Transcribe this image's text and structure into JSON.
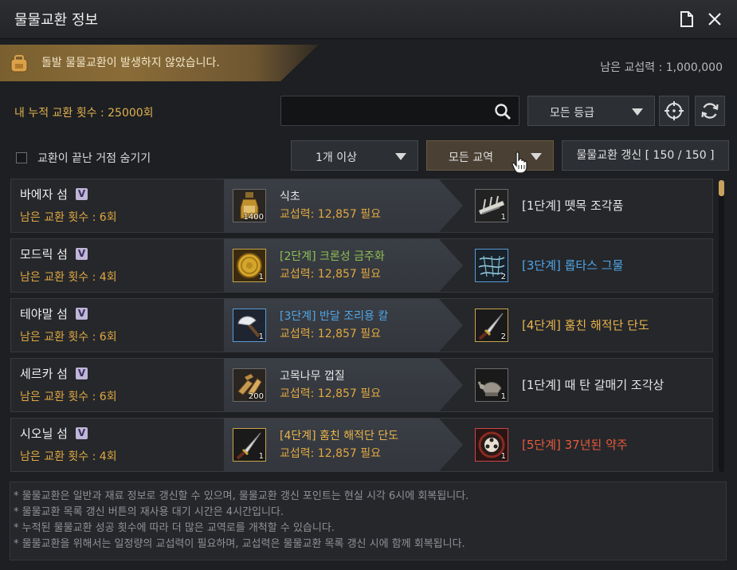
{
  "window": {
    "title": "물물교환 정보"
  },
  "alert": {
    "message": "돌발 물물교환이 발생하지 않았습니다."
  },
  "remaining_power": "남은 교섭력 : 1,000,000",
  "cumulative_count": "내 누적 교환 횟수 : 25000회",
  "search": {
    "value": "",
    "placeholder": ""
  },
  "grade_filter": {
    "selected": "모든 등급"
  },
  "count_filter": {
    "selected": "1개 이상"
  },
  "route_filter": {
    "selected": "모든 교역"
  },
  "hide_finished": {
    "label": "교환이 끝난 거점 숨기기",
    "checked": false
  },
  "refresh_button": {
    "label": "물물교환 갱신 [ 150 / 150 ]"
  },
  "rows": [
    {
      "island": "바에자 섬",
      "badge": "V",
      "count": "남은 교환 횟수 : 6회",
      "given": {
        "name": "식초",
        "qty": "1400",
        "cost": "교섭력: 12,857 필요",
        "color": "#e6e6e6"
      },
      "received": {
        "name": "[1단계] 뗏목 조각품",
        "qty": "1",
        "color": "#e6e6e6"
      }
    },
    {
      "island": "모드릭 섬",
      "badge": "V",
      "count": "남은 교환 횟수 : 4회",
      "given": {
        "name": "[2단계] 크론성 금주화",
        "qty": "1",
        "cost": "교섭력: 12,857 필요",
        "color": "#8fbf55"
      },
      "received": {
        "name": "[3단계] 롭타스 그물",
        "qty": "2",
        "color": "#4fa6e6"
      }
    },
    {
      "island": "테야말 섬",
      "badge": "V",
      "count": "남은 교환 횟수 : 6회",
      "given": {
        "name": "[3단계] 반달 조리용 칼",
        "qty": "1",
        "cost": "교섭력: 12,857 필요",
        "color": "#4fa6e6"
      },
      "received": {
        "name": "[4단계] 훔친 해적단 단도",
        "qty": "2",
        "color": "#e9b44c"
      }
    },
    {
      "island": "세르카 섬",
      "badge": "V",
      "count": "남은 교환 횟수 : 6회",
      "given": {
        "name": "고목나무 껍질",
        "qty": "200",
        "cost": "교섭력: 12,857 필요",
        "color": "#e6e6e6"
      },
      "received": {
        "name": "[1단계] 때 탄 갈매기 조각상",
        "qty": "1",
        "color": "#e6e6e6"
      }
    },
    {
      "island": "시오닐 섬",
      "badge": "V",
      "count": "남은 교환 횟수 : 4회",
      "given": {
        "name": "[4단계] 훔친 해적단 단도",
        "qty": "1",
        "cost": "교섭력: 12,857 필요",
        "color": "#e9b44c"
      },
      "received": {
        "name": "[5단계] 37년된 약주",
        "qty": "1",
        "color": "#e85a3a"
      }
    }
  ],
  "notes": [
    "* 물물교환은 일반과 재료 정보로 갱신할 수 있으며, 물물교환 갱신 포인트는 현실 시각 6시에 회복됩니다.",
    "* 물물교환 목록 갱신 버튼의 재사용 대기 시간은 4시간입니다.",
    "* 누적된 물물교환 성공 횟수에 따라 더 많은 교역로를 개척할 수 있습니다.",
    "* 물물교환을 위해서는 일정량의 교섭력이 필요하며, 교섭력은 물물교환 목록 갱신 시에 함께 회복됩니다."
  ]
}
